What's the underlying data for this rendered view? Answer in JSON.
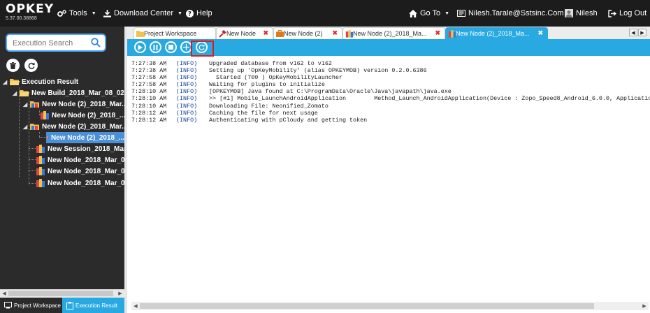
{
  "app": {
    "logo": "OPKEY",
    "version": "5.37.00.38868"
  },
  "topbar": {
    "tools": "Tools",
    "download_center": "Download Center",
    "help": "Help",
    "go_to": "Go To",
    "email": "Nilesh.Tarale@Sstsinc.Com",
    "user": "Nilesh",
    "logout": "Log Out"
  },
  "left": {
    "search_placeholder": "Execution Search",
    "tree": [
      "Execution Result",
      "New Build_2018_Mar_08_02...",
      "New Node (2)_2018_Mar...",
      "New Node (2)_2018_...",
      "New Node (2)_2018_Mar...",
      "New Node (2)_2018_...",
      "New Session_2018_Mar...",
      "New Node_2018_Mar_0...",
      "New Node_2018_Mar_0...",
      "New Node_2018_Mar_0..."
    ],
    "bottom_tabs": [
      "Project Workspace",
      "Execution Result"
    ]
  },
  "tabs": [
    "Project Workspace",
    "New Node",
    "New Node (2)",
    "New Node (2)_2018_Ma...",
    "New Node (2)_2018_Ma..."
  ],
  "log": [
    {
      "time": "7:27:38 AM",
      "level": "(INFO)",
      "msg": "Upgraded database from v162 to v162"
    },
    {
      "time": "7:27:38 AM",
      "level": "(INFO)",
      "msg": "Setting up 'OpKeyMobility' (alias OPKEYMOB) version 0.2.0.6386"
    },
    {
      "time": "7:27:58 AM",
      "level": "(INFO)",
      "msg": "  Started (700 ) OpKeyMobilityLauncher"
    },
    {
      "time": "7:27:58 AM",
      "level": "(INFO)",
      "msg": "Waiting for plugins to initialize"
    },
    {
      "time": "7:28:10 AM",
      "level": "(INFO)",
      "msg": "[OPKEYMOB] Java found at C:\\ProgramData\\Oracle\\Java\\javapath\\java.exe"
    },
    {
      "time": "7:28:10 AM",
      "level": "(INFO)",
      "msg": ">> [#1] Mobile_LaunchAndroidApplication        Method_Launch_AndroidApplication(Device : Zopo_Speed8_Android_6.0.0, Application"
    },
    {
      "time": "7:28:10 AM",
      "level": "(INFO)",
      "msg": "Downloading File: Neonified_Zomato"
    },
    {
      "time": "7:28:12 AM",
      "level": "(INFO)",
      "msg": "Caching the file for next usage"
    },
    {
      "time": "7:28:12 AM",
      "level": "(INFO)",
      "msg": "Authenticating with pCloudy and getting token"
    }
  ],
  "colors": {
    "accent": "#29a9e1",
    "topbar": "#1c1c1c",
    "panel": "#2b2b2b",
    "highlight": "#e01b1b",
    "info": "#0b3b9e"
  }
}
